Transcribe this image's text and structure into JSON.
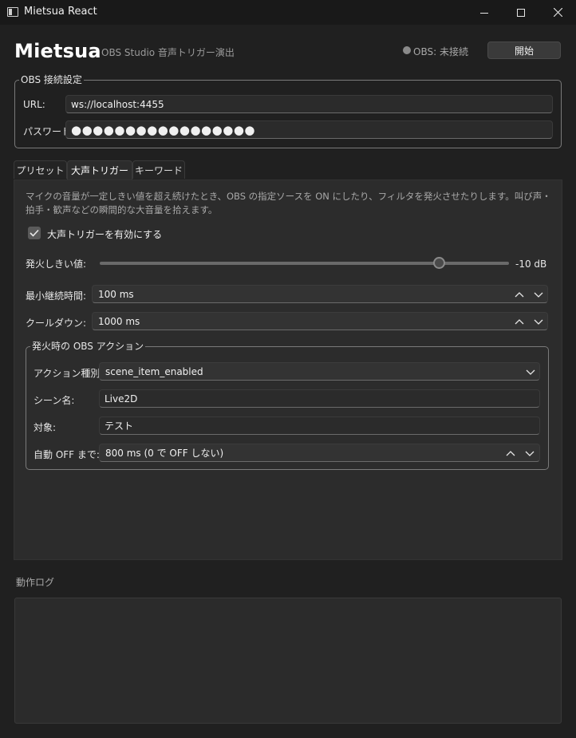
{
  "window": {
    "title": "Mietsua React",
    "icon": "app-window-icon",
    "controls": [
      "minimize-icon",
      "maximize-icon",
      "close-icon"
    ]
  },
  "header": {
    "title": "Mietsua",
    "subtitle": "OBS Studio 音声トリガー演出",
    "status_text": "OBS: 未接続",
    "start_button": "開始"
  },
  "connection": {
    "legend": "OBS 接続設定",
    "url_label": "URL:",
    "url_value": "ws://localhost:4455",
    "password_label": "パスワード:",
    "password_value": "●●●●●●●●●●●●●●●●●"
  },
  "tabs": [
    {
      "label": "プリセット",
      "active": false
    },
    {
      "label": "大声トリガー",
      "active": true
    },
    {
      "label": "キーワード",
      "active": false
    }
  ],
  "trigger": {
    "description": "マイクの音量が一定しきい値を超え続けたとき、OBS の指定ソースを ON にしたり、フィルタを発火させたりします。叫び声・拍手・歓声などの瞬間的な大音量を拾えます。",
    "enable_label": "大声トリガーを有効にする",
    "enabled": true,
    "threshold_label": "発火しきい値:",
    "threshold_value": "-10 dB",
    "threshold_fraction": 0.83,
    "min_duration_label": "最小継続時間:",
    "min_duration_value": "100 ms",
    "cooldown_label": "クールダウン:",
    "cooldown_value": "1000 ms"
  },
  "action": {
    "legend": "発火時の OBS アクション",
    "type_label": "アクション種別:",
    "type_value": "scene_item_enabled",
    "scene_label": "シーン名:",
    "scene_value": "Live2D",
    "target_label": "対象:",
    "target_value": "テスト",
    "auto_off_label": "自動 OFF まで:",
    "auto_off_value": "800 ms (0 で OFF しない)"
  },
  "log": {
    "label": "動作ログ"
  },
  "colors": {
    "background": "#202020",
    "panel": "#2c2c2c",
    "status_dot": "#8a8a8a"
  }
}
